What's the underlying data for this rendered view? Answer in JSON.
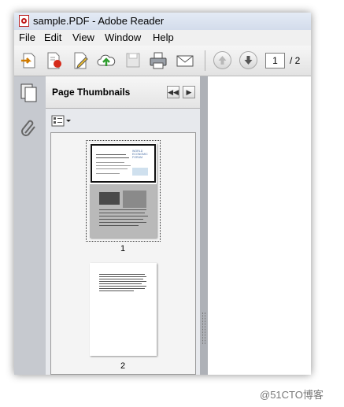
{
  "window": {
    "title": "sample.PDF - Adobe Reader"
  },
  "menu": {
    "items": [
      "File",
      "Edit",
      "View",
      "Window",
      "Help"
    ]
  },
  "toolbar": {
    "buttons": [
      "open-icon",
      "create-pdf-icon",
      "edit-icon",
      "cloud-upload-icon",
      "save-icon",
      "print-icon",
      "email-icon",
      "previous-page-icon",
      "next-page-icon"
    ],
    "page_current": "1",
    "page_total": "/ 2"
  },
  "panel": {
    "title": "Page Thumbnails",
    "thumbnails": [
      {
        "label": "1",
        "selected": true,
        "thumb_heading": "WORLD ECONOMIC FORUM"
      },
      {
        "label": "2",
        "selected": false
      }
    ]
  },
  "watermark": "@51CTO博客"
}
